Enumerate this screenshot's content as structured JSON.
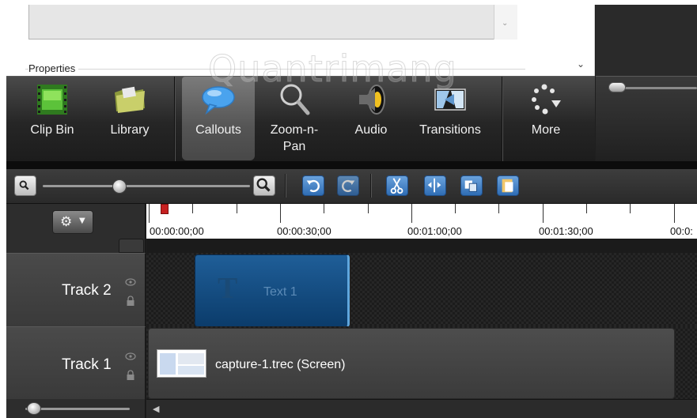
{
  "properties": {
    "label": "Properties"
  },
  "tabs": [
    {
      "id": "clip-bin",
      "label": "Clip Bin",
      "active": false
    },
    {
      "id": "library",
      "label": "Library",
      "active": false
    },
    {
      "id": "callouts",
      "label": "Callouts",
      "active": true
    },
    {
      "id": "zoom-n-pan",
      "label": "Zoom-n-Pan",
      "line1": "Zoom-n-",
      "line2": "Pan",
      "active": false
    },
    {
      "id": "audio",
      "label": "Audio",
      "active": false
    },
    {
      "id": "transitions",
      "label": "Transitions",
      "active": false
    },
    {
      "id": "more",
      "label": "More",
      "active": false
    }
  ],
  "ruler": {
    "labels": [
      "00:00:00;00",
      "00:00:30;00",
      "00:01:00;00",
      "00:01:30;00",
      "00:0:"
    ]
  },
  "tracks": [
    {
      "name": "Track 2",
      "clip": {
        "label": "Text 1",
        "type": "callout"
      }
    },
    {
      "name": "Track 1",
      "clip": {
        "label": "capture-1.trec (Screen)",
        "type": "screen"
      }
    }
  ],
  "watermark": "Quantrimang",
  "colors": {
    "accent_blue": "#2f6db4",
    "playhead": "#c62020",
    "callout_clip": "#1f5e98"
  }
}
